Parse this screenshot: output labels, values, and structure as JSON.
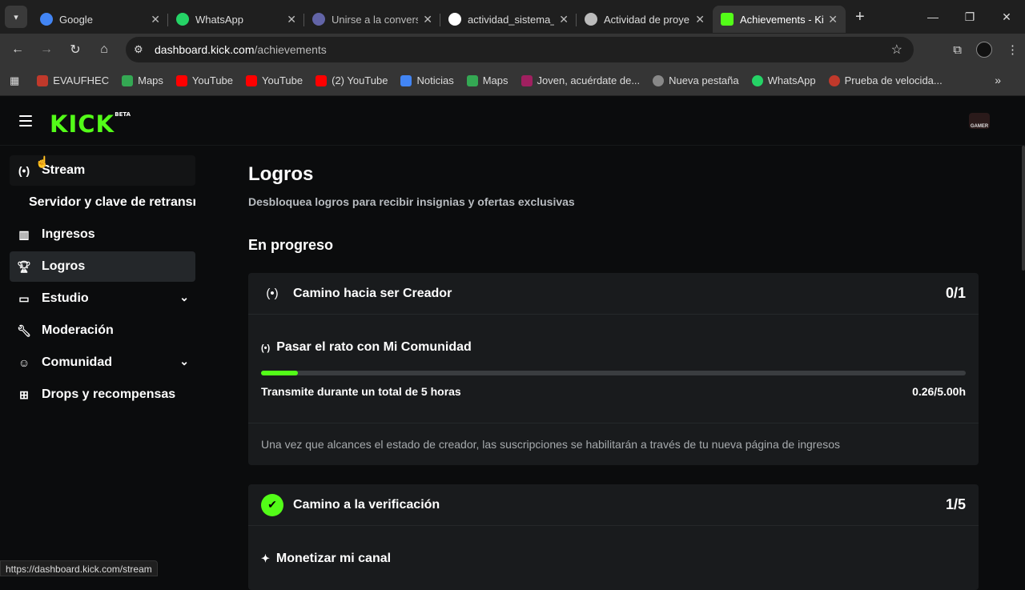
{
  "browser": {
    "tabs": [
      {
        "title": "Google",
        "color": "#4285f4"
      },
      {
        "title": "WhatsApp",
        "color": "#25d366"
      },
      {
        "title": "Unirse a la convers",
        "color": "#6264a7"
      },
      {
        "title": "actividad_sistema_",
        "color": "#ffffff"
      },
      {
        "title": "Actividad de proye",
        "color": "#bbbbbb"
      },
      {
        "title": "Achievements - Ki",
        "color": "#53fc18"
      }
    ],
    "url_host": "dashboard.kick.com",
    "url_path": "/achievements",
    "bookmarks": [
      {
        "label": "EVAUFHEC",
        "color": "#c0392b"
      },
      {
        "label": "Maps",
        "color": "#34a853"
      },
      {
        "label": "YouTube",
        "color": "#ff0000"
      },
      {
        "label": "YouTube",
        "color": "#ff0000"
      },
      {
        "label": "(2) YouTube",
        "color": "#ff0000"
      },
      {
        "label": "Noticias",
        "color": "#4285f4"
      },
      {
        "label": "Maps",
        "color": "#34a853"
      },
      {
        "label": "Joven, acuérdate de...",
        "color": "#a02060"
      },
      {
        "label": "Nueva pestaña",
        "color": "#888888"
      },
      {
        "label": "WhatsApp",
        "color": "#25d366"
      },
      {
        "label": "Prueba de velocida...",
        "color": "#c0392b"
      }
    ],
    "status_url": "https://dashboard.kick.com/stream"
  },
  "app": {
    "logo": "KICK",
    "logo_badge": "BETA",
    "avatar_text": "GAMER",
    "accent": "#53fc18"
  },
  "sidebar": {
    "items": [
      {
        "label": "Stream",
        "icon": "broadcast-icon"
      },
      {
        "label": "Servidor y clave de retransm",
        "icon": ""
      },
      {
        "label": "Ingresos",
        "icon": "bar-chart-icon"
      },
      {
        "label": "Logros",
        "icon": "trophy-icon"
      },
      {
        "label": "Estudio",
        "icon": "studio-icon"
      },
      {
        "label": "Moderación",
        "icon": "wrench-icon"
      },
      {
        "label": "Comunidad",
        "icon": "community-icon"
      },
      {
        "label": "Drops y recompensas",
        "icon": "gift-icon"
      }
    ]
  },
  "main": {
    "title": "Logros",
    "subtitle": "Desbloquea logros para recibir insignias y ofertas exclusivas",
    "section": "En progreso",
    "card1": {
      "title": "Camino hacia ser Creador",
      "count": "0/1",
      "task_title": "Pasar el rato con Mi Comunidad",
      "task_desc": "Transmite durante un total de 5 horas",
      "task_value": "0.26/5.00h",
      "progress": 0.052,
      "footer": "Una vez que alcances el estado de creador, las suscripciones se habilitarán a través de tu nueva página de ingresos"
    },
    "card2": {
      "title": "Camino a la verificación",
      "count": "1/5",
      "task_title": "Monetizar mi canal"
    }
  }
}
